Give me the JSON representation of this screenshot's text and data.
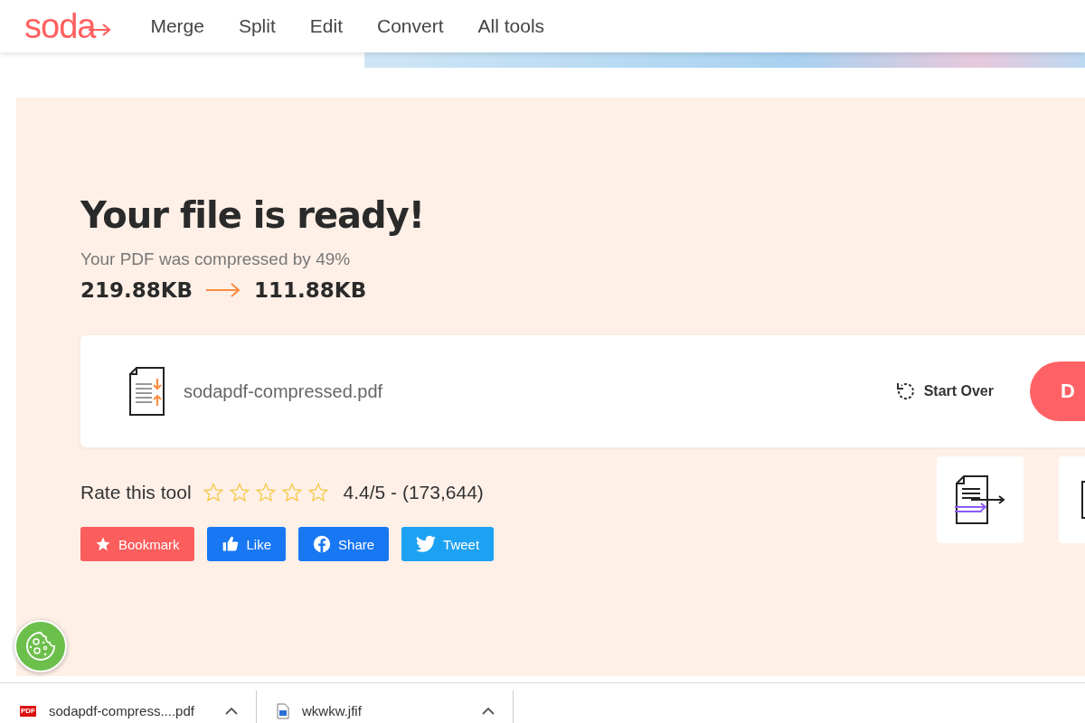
{
  "header": {
    "logo": "soda",
    "nav": [
      {
        "label": "Merge"
      },
      {
        "label": "Split"
      },
      {
        "label": "Edit"
      },
      {
        "label": "Convert"
      },
      {
        "label": "All tools"
      }
    ]
  },
  "result": {
    "title": "Your file is ready!",
    "subtitle": "Your PDF was compressed by 49%",
    "size_before": "219.88KB",
    "size_after": "111.88KB",
    "file_name": "sodapdf-compressed.pdf",
    "start_over": "Start Over",
    "download_button": "D"
  },
  "rating": {
    "label": "Rate this tool",
    "stars": 0,
    "score": "4.4/5 - (173,644)"
  },
  "social_buttons": [
    {
      "kind": "bookmark",
      "label": "Bookmark"
    },
    {
      "kind": "like",
      "label": "Like"
    },
    {
      "kind": "share",
      "label": "Share"
    },
    {
      "kind": "tweet",
      "label": "Tweet"
    }
  ],
  "downloads": [
    {
      "kind": "pdf",
      "badge": "PDF",
      "name": "sodapdf-compress....pdf"
    },
    {
      "kind": "image",
      "name": "wkwkw.jfif"
    }
  ]
}
